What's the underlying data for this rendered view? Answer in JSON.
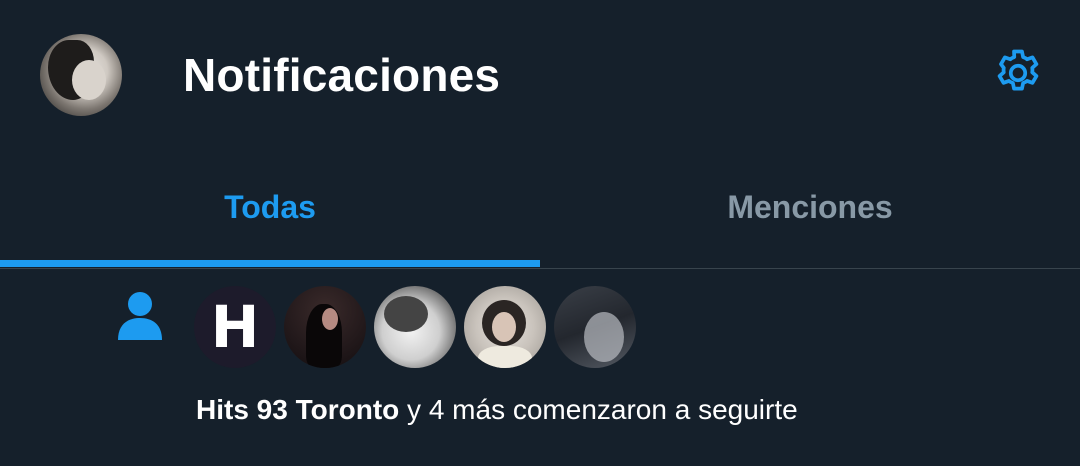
{
  "header": {
    "title": "Notificaciones",
    "avatar_icon": "profile-avatar",
    "settings_icon": "gear-icon",
    "accent_color": "#1d9bf0"
  },
  "tabs": [
    {
      "label": "Todas",
      "selected": true
    },
    {
      "label": "Menciones",
      "selected": false
    }
  ],
  "notification": {
    "type_icon": "person-icon",
    "avatars": [
      "H",
      "",
      "",
      "",
      ""
    ],
    "actor_name": "Hits 93 Toronto",
    "action_text": " y 4 más comenzaron a seguirte"
  },
  "colors": {
    "background": "#15202b",
    "accent": "#1d9bf0",
    "muted": "#8899a6",
    "divider": "#38444d"
  }
}
